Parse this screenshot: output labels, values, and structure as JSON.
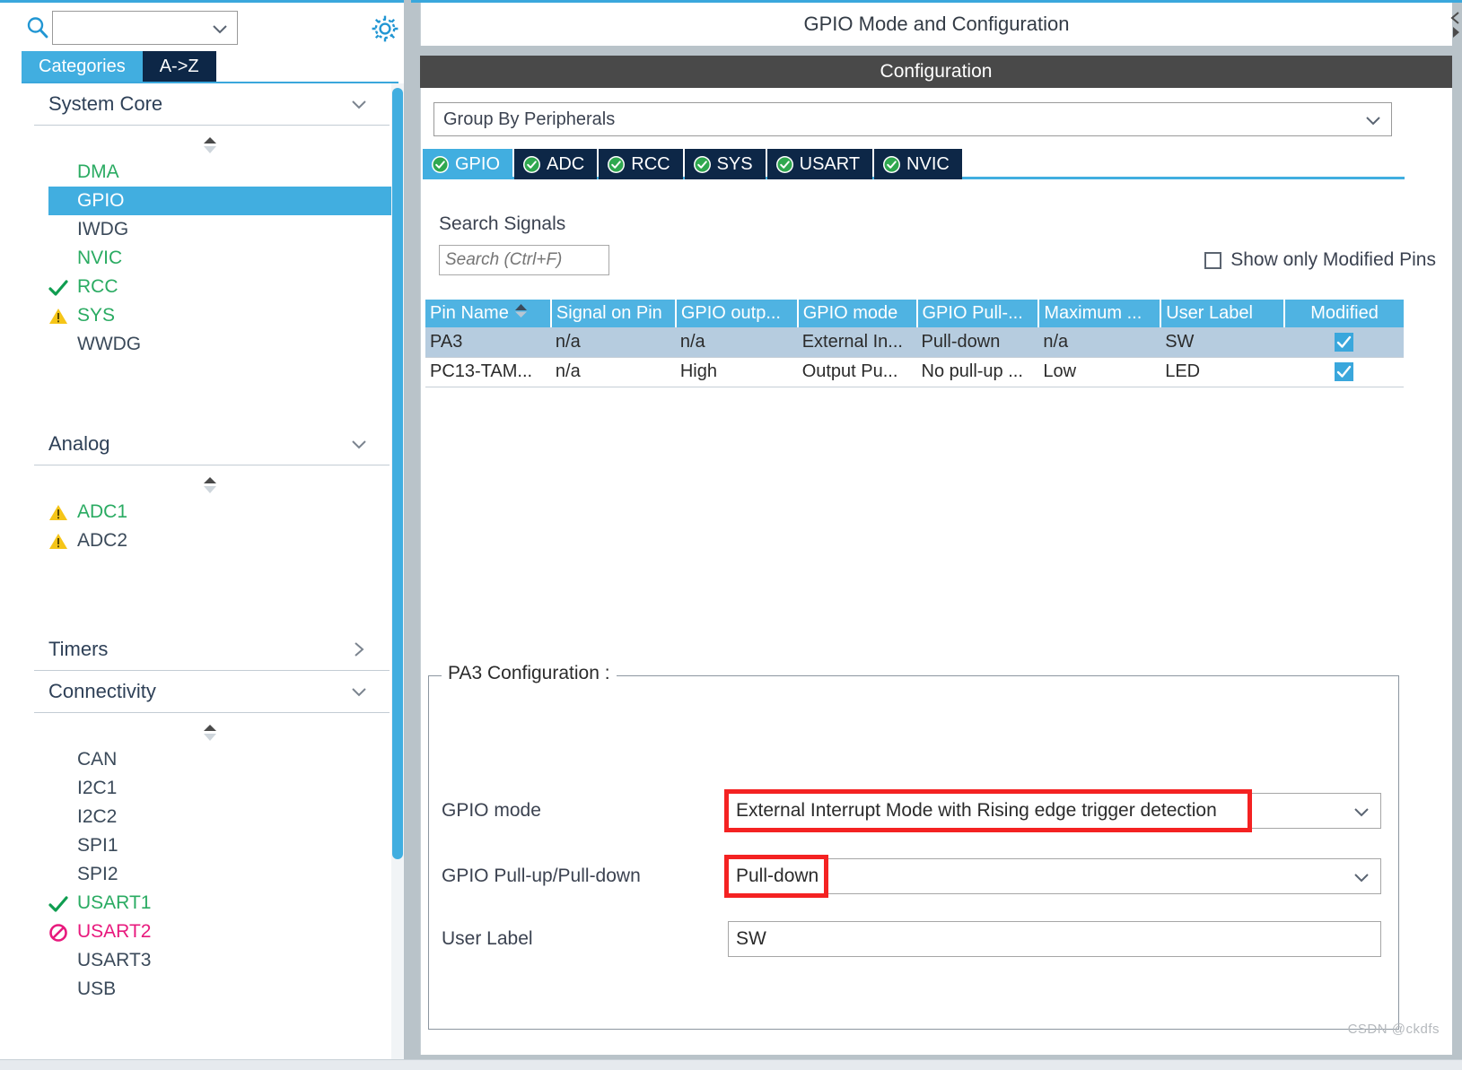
{
  "sidebar": {
    "search_value": "",
    "tabs": [
      {
        "label": "Categories",
        "active": true
      },
      {
        "label": "A->Z",
        "active": false
      }
    ],
    "groups": [
      {
        "title": "System Core",
        "expanded": true,
        "items": [
          {
            "label": "DMA",
            "status": "none",
            "color": "green",
            "selected": false
          },
          {
            "label": "GPIO",
            "status": "none",
            "color": "white",
            "selected": true
          },
          {
            "label": "IWDG",
            "status": "none",
            "color": "dark",
            "selected": false
          },
          {
            "label": "NVIC",
            "status": "none",
            "color": "green",
            "selected": false
          },
          {
            "label": "RCC",
            "status": "check",
            "color": "green",
            "selected": false
          },
          {
            "label": "SYS",
            "status": "warning",
            "color": "green",
            "selected": false
          },
          {
            "label": "WWDG",
            "status": "none",
            "color": "dark",
            "selected": false
          }
        ]
      },
      {
        "title": "Analog",
        "expanded": true,
        "items": [
          {
            "label": "ADC1",
            "status": "warning",
            "color": "green",
            "selected": false
          },
          {
            "label": "ADC2",
            "status": "warning",
            "color": "dark",
            "selected": false
          }
        ]
      },
      {
        "title": "Timers",
        "expanded": false,
        "items": []
      },
      {
        "title": "Connectivity",
        "expanded": true,
        "items": [
          {
            "label": "CAN",
            "status": "none",
            "color": "dark",
            "selected": false
          },
          {
            "label": "I2C1",
            "status": "none",
            "color": "dark",
            "selected": false
          },
          {
            "label": "I2C2",
            "status": "none",
            "color": "dark",
            "selected": false
          },
          {
            "label": "SPI1",
            "status": "none",
            "color": "dark",
            "selected": false
          },
          {
            "label": "SPI2",
            "status": "none",
            "color": "dark",
            "selected": false
          },
          {
            "label": "USART1",
            "status": "check",
            "color": "green",
            "selected": false
          },
          {
            "label": "USART2",
            "status": "forbidden",
            "color": "pink",
            "selected": false
          },
          {
            "label": "USART3",
            "status": "none",
            "color": "dark",
            "selected": false
          },
          {
            "label": "USB",
            "status": "none",
            "color": "dark",
            "selected": false
          }
        ]
      }
    ]
  },
  "header": {
    "title": "GPIO Mode and Configuration",
    "configuration_bar": "Configuration"
  },
  "config": {
    "group_by": "Group By Peripherals",
    "peripheral_tabs": [
      {
        "label": "GPIO",
        "active": true
      },
      {
        "label": "ADC",
        "active": false
      },
      {
        "label": "RCC",
        "active": false
      },
      {
        "label": "SYS",
        "active": false
      },
      {
        "label": "USART",
        "active": false
      },
      {
        "label": "NVIC",
        "active": false
      }
    ],
    "search_signals_label": "Search Signals",
    "search_placeholder": "Search (Ctrl+F)",
    "search_value": "",
    "show_only_modified_label": "Show only Modified Pins",
    "show_only_modified_checked": false
  },
  "table": {
    "columns": [
      "Pin Name",
      "Signal on Pin",
      "GPIO outp...",
      "GPIO mode",
      "GPIO Pull-...",
      "Maximum ...",
      "User Label",
      "Modified"
    ],
    "sort_column": "Pin Name",
    "sort_direction": "ascending",
    "rows": [
      {
        "selected": true,
        "pin_name": "PA3",
        "signal_on_pin": "n/a",
        "gpio_output": "n/a",
        "gpio_mode": "External In...",
        "gpio_pull": "Pull-down",
        "maximum": "n/a",
        "user_label": "SW",
        "modified": true
      },
      {
        "selected": false,
        "pin_name": "PC13-TAM...",
        "signal_on_pin": "n/a",
        "gpio_output": "High",
        "gpio_mode": "Output Pu...",
        "gpio_pull": "No pull-up ...",
        "maximum": "Low",
        "user_label": "LED",
        "modified": true
      }
    ]
  },
  "pin_config": {
    "legend": "PA3 Configuration :",
    "fields": [
      {
        "label": "GPIO mode",
        "value": "External Interrupt Mode with Rising edge trigger detection",
        "type": "dropdown",
        "highlighted": true,
        "highlight_width": 588
      },
      {
        "label": "GPIO Pull-up/Pull-down",
        "value": "Pull-down",
        "type": "dropdown",
        "highlighted": true,
        "highlight_width": 116
      },
      {
        "label": "User Label",
        "value": "SW",
        "type": "text",
        "highlighted": false,
        "highlight_width": 0
      }
    ]
  },
  "colors": {
    "accent_blue": "#41aee0",
    "tab_dark": "#0d2747",
    "table_header": "#4fb3e2",
    "row_selected": "#b6ccdf",
    "highlight_red": "#f42222",
    "status_green": "#2aab62",
    "status_warning": "#f5c518",
    "status_forbidden": "#e8197d"
  },
  "watermark": "CSDN @ckdfs"
}
